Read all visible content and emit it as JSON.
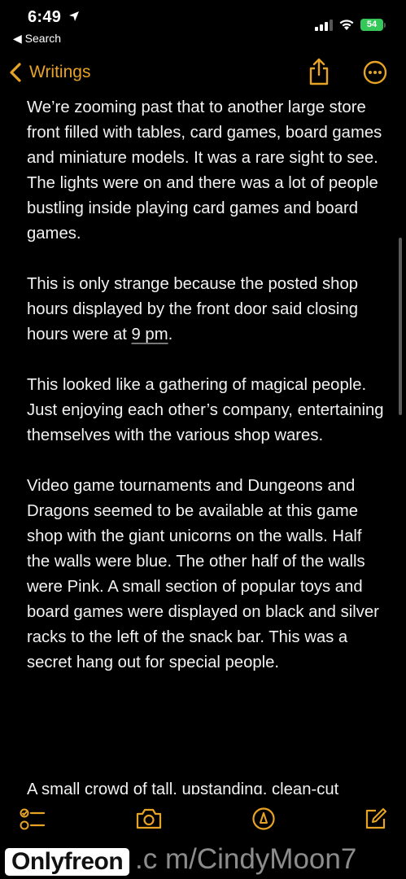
{
  "status": {
    "time": "6:49",
    "back_app": "Search",
    "battery": "54"
  },
  "nav": {
    "back_label": "Writings"
  },
  "note": {
    "paragraphs": [
      "We’re zooming past that to another large store front filled with tables, card games, board games and miniature models. It was a rare sight to see. The lights were on and there was a lot of people bustling inside playing card games and board games.",
      "This is only strange because the posted shop hours displayed by the front door said closing hours were at ",
      "9 pm",
      ".",
      "This looked like a gathering of magical people. Just enjoying each other’s company, entertaining themselves with the various shop wares.",
      "Video game tournaments and Dungeons and Dragons seemed to be available at this game shop with the giant unicorns on the walls. Half the walls were blue. The other half of the walls were Pink. A small section of popular toys and board games were displayed on black and silver racks to the left of the snack bar. This was a secret hang out for special people.",
      "A small crowd of tall, upstanding, clean-cut"
    ]
  },
  "watermark": {
    "logo": "Onlyfreon",
    "text": ".c m/CindyMoon7"
  },
  "colors": {
    "accent": "#e6a324",
    "background": "#000000",
    "battery": "#35c759"
  },
  "icons": [
    "location-arrow-icon",
    "signal-icon",
    "wifi-icon",
    "chevron-left-icon",
    "share-icon",
    "more-icon",
    "checklist-icon",
    "camera-icon",
    "markup-pen-icon",
    "compose-icon"
  ]
}
